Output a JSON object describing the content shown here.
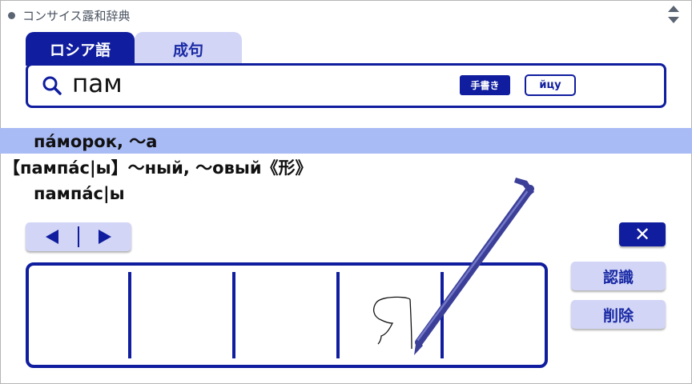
{
  "app": {
    "title": "コンサイス露和辞典"
  },
  "tabs": [
    {
      "label": "ロシア語",
      "active": true
    },
    {
      "label": "成句",
      "active": false
    }
  ],
  "search": {
    "query": "пам",
    "handwriting_label": "手書き",
    "keyboard_label": "йцу"
  },
  "results": [
    {
      "text": "па́морок, ～а",
      "selected": true
    },
    {
      "text": "【пампа́с|ы】～ный, ～овый《形》",
      "selected": false
    },
    {
      "text": "пампа́с|ы",
      "selected": false
    }
  ],
  "navigation": {
    "prev_icon": "left-triangle-icon",
    "next_icon": "right-triangle-icon"
  },
  "close_button": {
    "label": "✕"
  },
  "handwriting_pad": {
    "cells": 5
  },
  "buttons": {
    "recognize": "認識",
    "delete": "削除"
  },
  "colors": {
    "accent": "#0f1d9e",
    "light_button": "#d2d5f5",
    "selection": "#a9bbf5"
  }
}
